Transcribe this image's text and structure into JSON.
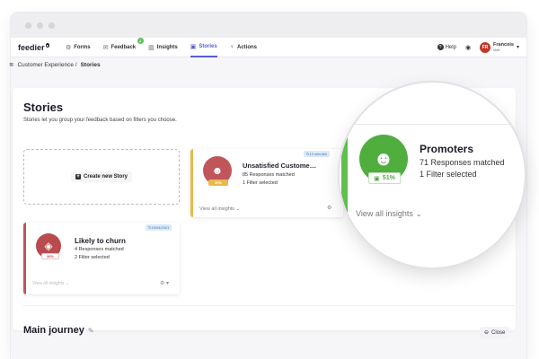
{
  "nav": {
    "logo": "feedier",
    "items": [
      {
        "label": "Forms",
        "icon": "forms-icon"
      },
      {
        "label": "Feedback",
        "icon": "feedback-icon",
        "badge": "1"
      },
      {
        "label": "Insights",
        "icon": "insights-icon"
      },
      {
        "label": "Stories",
        "icon": "stories-icon",
        "active": true
      },
      {
        "label": "Actions",
        "icon": "actions-icon"
      }
    ],
    "help": "Help",
    "user": {
      "initials": "FR",
      "name": "Francois",
      "role": "staff"
    }
  },
  "breadcrumb": {
    "parent": "Customer Experience /",
    "current": "Stories"
  },
  "page": {
    "title": "Stories",
    "subtitle": "Stories let you group your feedback based on filters you choose.",
    "create_label": "Create new Story"
  },
  "stories": {
    "churn": {
      "title": "Likely to churn",
      "responses": "4 Responses matched",
      "filters": "2 Filter selected",
      "pct": "36%",
      "date": "15/04/2021",
      "view": "View all insights",
      "color": "#c0565a"
    },
    "unsat": {
      "title": "Unsatisfied Custome…",
      "responses": "85 Responses matched",
      "filters": "1 Filter selected",
      "pct": "20%",
      "date": "13 minutes",
      "view": "View all insights",
      "color": "#e8b94a"
    },
    "promoters": {
      "title": "Promoters",
      "responses": "71 Responses matched",
      "filters": "1 Filter selected",
      "pct": "51%",
      "view": "View all insights",
      "color": "#5fbf4a"
    }
  },
  "journey": {
    "title": "Main journey",
    "close_label": "Close"
  }
}
